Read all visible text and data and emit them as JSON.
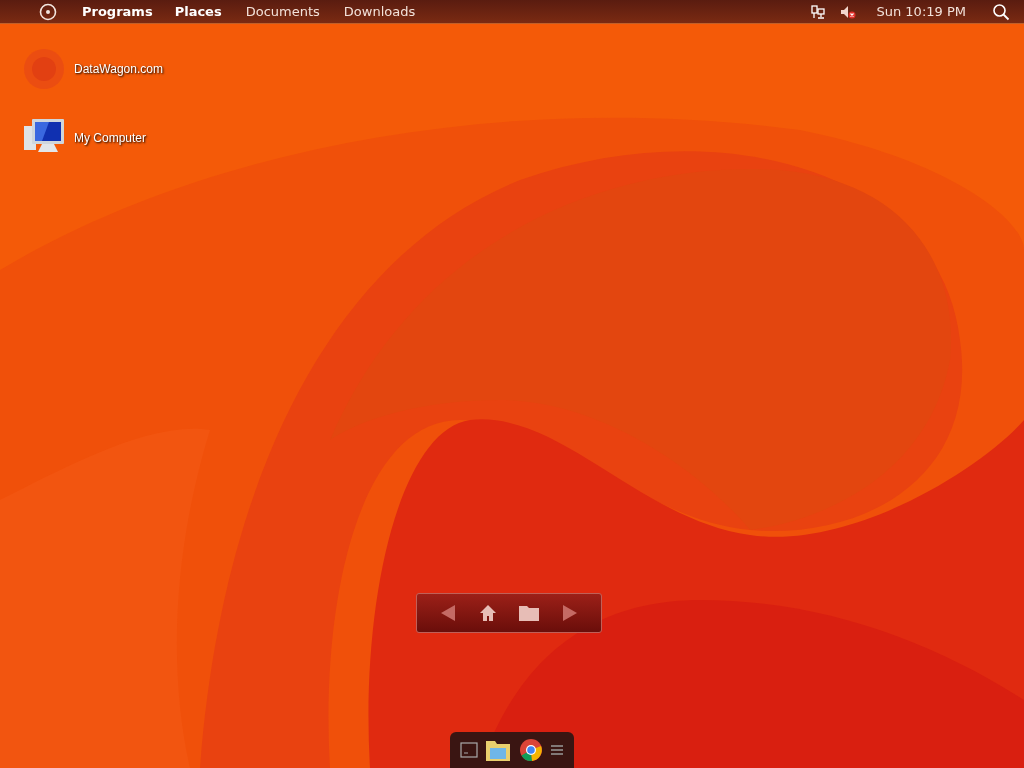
{
  "menu_bar": {
    "items": [
      {
        "label": "Programs",
        "kind": "menu"
      },
      {
        "label": "Places",
        "kind": "menu"
      },
      {
        "label": "Documents",
        "kind": "folder"
      },
      {
        "label": "Downloads",
        "kind": "folder"
      }
    ],
    "clock": "Sun 10:19 PM"
  },
  "desktop_icons": [
    {
      "label": "DataWagon.com",
      "kind": "web"
    },
    {
      "label": "My Computer",
      "kind": "computer"
    }
  ]
}
